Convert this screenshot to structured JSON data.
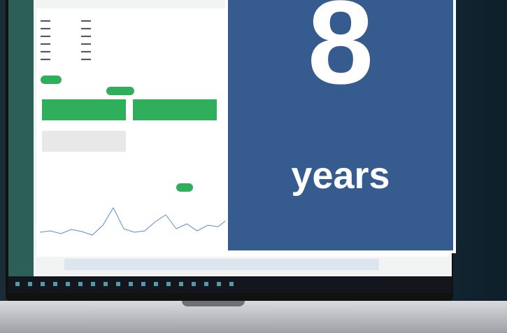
{
  "promo": {
    "number": "8",
    "word": "years"
  }
}
